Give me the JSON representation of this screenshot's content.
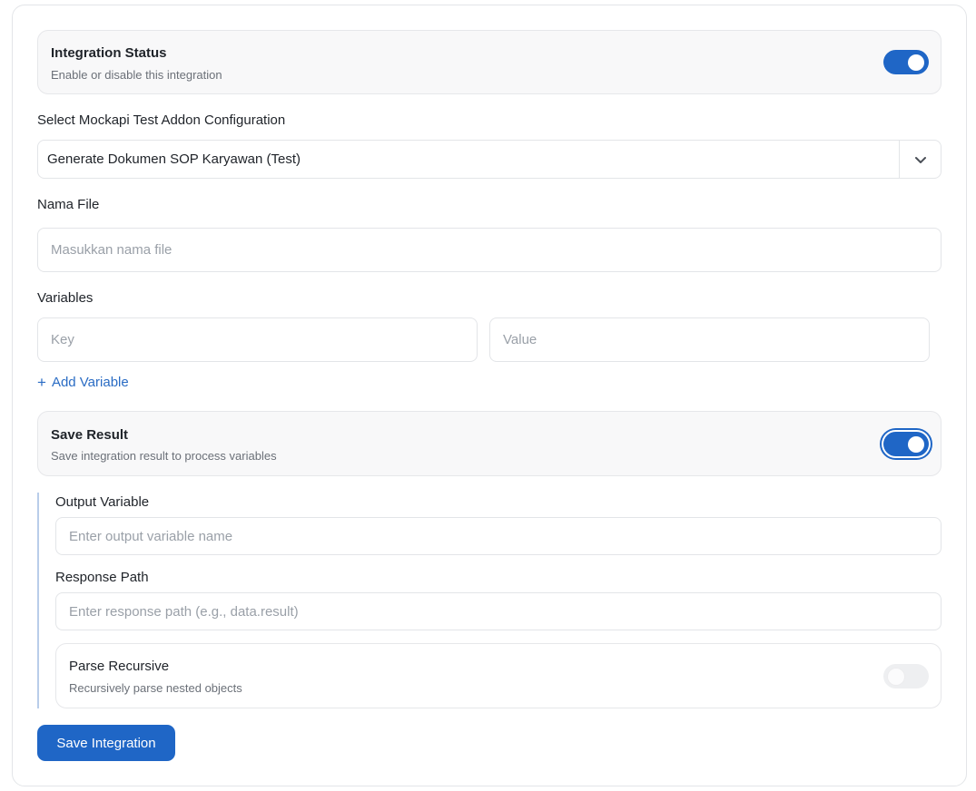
{
  "integration_status": {
    "title": "Integration Status",
    "description": "Enable or disable this integration",
    "enabled": true
  },
  "addon_config": {
    "label": "Select Mockapi Test Addon Configuration",
    "selected": "Generate Dokumen SOP Karyawan (Test)"
  },
  "file_name": {
    "label": "Nama File",
    "placeholder": "Masukkan nama file",
    "value": ""
  },
  "variables": {
    "label": "Variables",
    "key_placeholder": "Key",
    "value_placeholder": "Value",
    "add_label": "Add Variable"
  },
  "save_result": {
    "title": "Save Result",
    "description": "Save integration result to process variables",
    "enabled": true
  },
  "output_variable": {
    "label": "Output Variable",
    "placeholder": "Enter output variable name"
  },
  "response_path": {
    "label": "Response Path",
    "placeholder": "Enter response path (e.g., data.result)"
  },
  "parse_recursive": {
    "title": "Parse Recursive",
    "description": "Recursively parse nested objects",
    "enabled": false
  },
  "actions": {
    "save_label": "Save Integration"
  },
  "colors": {
    "accent": "#1f66c6",
    "link": "#2a6cc4"
  }
}
